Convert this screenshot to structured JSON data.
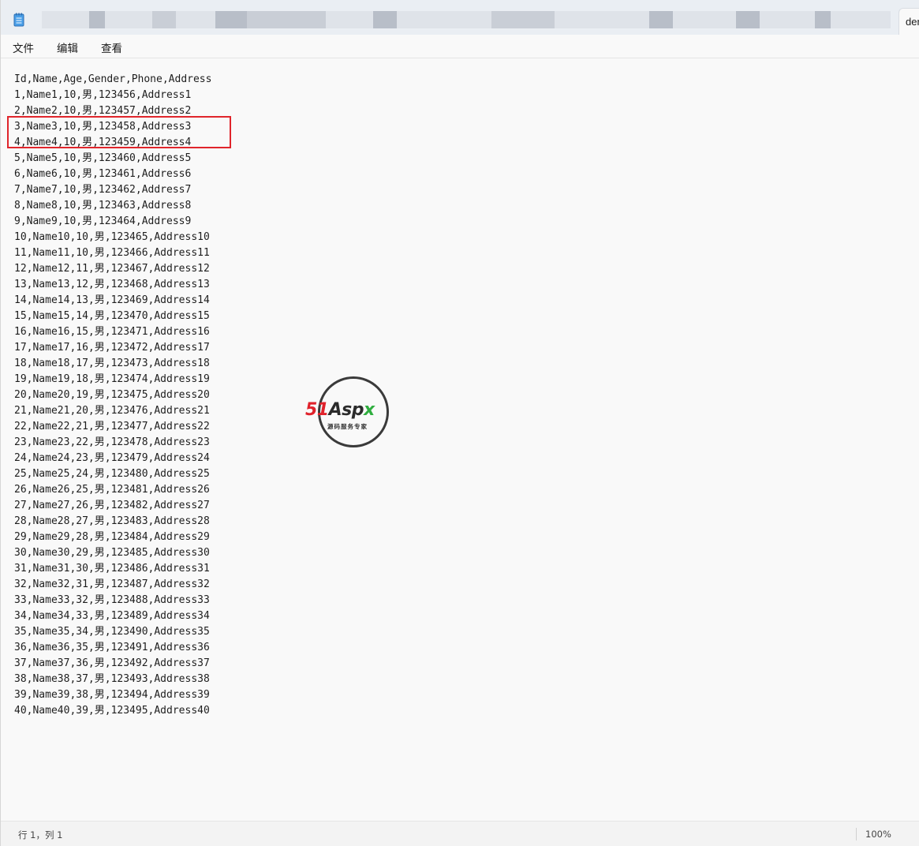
{
  "window": {
    "tab_label": "dem"
  },
  "menu": {
    "items": [
      "文件",
      "编辑",
      "查看"
    ]
  },
  "document": {
    "lines": [
      "Id,Name,Age,Gender,Phone,Address",
      "1,Name1,10,男,123456,Address1",
      "2,Name2,10,男,123457,Address2",
      "3,Name3,10,男,123458,Address3",
      "4,Name4,10,男,123459,Address4",
      "5,Name5,10,男,123460,Address5",
      "6,Name6,10,男,123461,Address6",
      "7,Name7,10,男,123462,Address7",
      "8,Name8,10,男,123463,Address8",
      "9,Name9,10,男,123464,Address9",
      "10,Name10,10,男,123465,Address10",
      "11,Name11,10,男,123466,Address11",
      "12,Name12,11,男,123467,Address12",
      "13,Name13,12,男,123468,Address13",
      "14,Name14,13,男,123469,Address14",
      "15,Name15,14,男,123470,Address15",
      "16,Name16,15,男,123471,Address16",
      "17,Name17,16,男,123472,Address17",
      "18,Name18,17,男,123473,Address18",
      "19,Name19,18,男,123474,Address19",
      "20,Name20,19,男,123475,Address20",
      "21,Name21,20,男,123476,Address21",
      "22,Name22,21,男,123477,Address22",
      "23,Name23,22,男,123478,Address23",
      "24,Name24,23,男,123479,Address24",
      "25,Name25,24,男,123480,Address25",
      "26,Name26,25,男,123481,Address26",
      "27,Name27,26,男,123482,Address27",
      "28,Name28,27,男,123483,Address28",
      "29,Name29,28,男,123484,Address29",
      "30,Name30,29,男,123485,Address30",
      "31,Name31,30,男,123486,Address31",
      "32,Name32,31,男,123487,Address32",
      "33,Name33,32,男,123488,Address33",
      "34,Name34,33,男,123489,Address34",
      "35,Name35,34,男,123490,Address35",
      "36,Name36,35,男,123491,Address36",
      "37,Name37,36,男,123492,Address37",
      "38,Name38,37,男,123493,Address38",
      "39,Name39,38,男,123494,Address39",
      "40,Name40,39,男,123495,Address40"
    ]
  },
  "watermark": {
    "brand_51": "51",
    "brand_asp": "Asp",
    "brand_x": "x",
    "tagline": "源码服务专家"
  },
  "status": {
    "position": "行 1，列 1",
    "zoom": "100%"
  },
  "colors": {
    "highlight_box": "#e0252b",
    "brand_red": "#e0222b",
    "brand_green": "#2fae3f"
  },
  "icons": {
    "app": "notepad-icon"
  }
}
